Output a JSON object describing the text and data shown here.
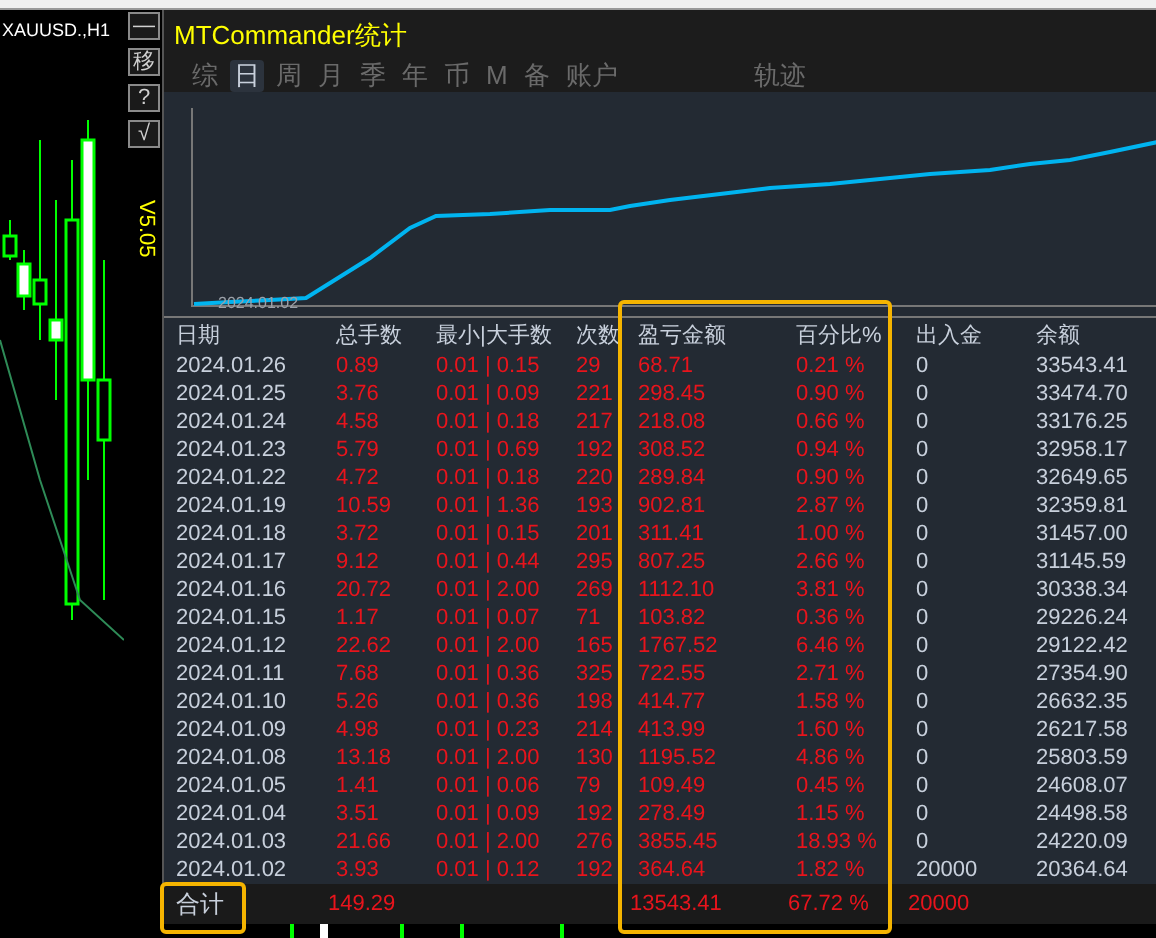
{
  "chart_window": {
    "symbol": "XAUUSD.,H1",
    "version": "V5.05",
    "side_buttons": [
      "—",
      "移",
      "?",
      "√"
    ]
  },
  "panel": {
    "title": "MTCommander统计",
    "tabs": [
      {
        "label": "综",
        "selected": false
      },
      {
        "label": "日",
        "selected": true
      },
      {
        "label": "周",
        "selected": false
      },
      {
        "label": "月",
        "selected": false
      },
      {
        "label": "季",
        "selected": false
      },
      {
        "label": "年",
        "selected": false
      },
      {
        "label": "币",
        "selected": false
      },
      {
        "label": "M",
        "selected": false
      },
      {
        "label": "备",
        "selected": false
      },
      {
        "label": "账户",
        "selected": false
      },
      {
        "label": "轨迹",
        "selected": false
      }
    ],
    "equity_chart": {
      "start_label": "2024.01.02"
    },
    "table": {
      "columns": [
        "日期",
        "总手数",
        "最小|大手数",
        "次数",
        "盈亏金额",
        "百分比%",
        "出入金",
        "余额"
      ],
      "rows": [
        [
          "2024.01.26",
          "0.89",
          "0.01 | 0.15",
          "29",
          "68.71",
          "0.21 %",
          "0",
          "33543.41"
        ],
        [
          "2024.01.25",
          "3.76",
          "0.01 | 0.09",
          "221",
          "298.45",
          "0.90 %",
          "0",
          "33474.70"
        ],
        [
          "2024.01.24",
          "4.58",
          "0.01 | 0.18",
          "217",
          "218.08",
          "0.66 %",
          "0",
          "33176.25"
        ],
        [
          "2024.01.23",
          "5.79",
          "0.01 | 0.69",
          "192",
          "308.52",
          "0.94 %",
          "0",
          "32958.17"
        ],
        [
          "2024.01.22",
          "4.72",
          "0.01 | 0.18",
          "220",
          "289.84",
          "0.90 %",
          "0",
          "32649.65"
        ],
        [
          "2024.01.19",
          "10.59",
          "0.01 | 1.36",
          "193",
          "902.81",
          "2.87 %",
          "0",
          "32359.81"
        ],
        [
          "2024.01.18",
          "3.72",
          "0.01 | 0.15",
          "201",
          "311.41",
          "1.00 %",
          "0",
          "31457.00"
        ],
        [
          "2024.01.17",
          "9.12",
          "0.01 | 0.44",
          "295",
          "807.25",
          "2.66 %",
          "0",
          "31145.59"
        ],
        [
          "2024.01.16",
          "20.72",
          "0.01 | 2.00",
          "269",
          "1112.10",
          "3.81 %",
          "0",
          "30338.34"
        ],
        [
          "2024.01.15",
          "1.17",
          "0.01 | 0.07",
          "71",
          "103.82",
          "0.36 %",
          "0",
          "29226.24"
        ],
        [
          "2024.01.12",
          "22.62",
          "0.01 | 2.00",
          "165",
          "1767.52",
          "6.46 %",
          "0",
          "29122.42"
        ],
        [
          "2024.01.11",
          "7.68",
          "0.01 | 0.36",
          "325",
          "722.55",
          "2.71 %",
          "0",
          "27354.90"
        ],
        [
          "2024.01.10",
          "5.26",
          "0.01 | 0.36",
          "198",
          "414.77",
          "1.58 %",
          "0",
          "26632.35"
        ],
        [
          "2024.01.09",
          "4.98",
          "0.01 | 0.23",
          "214",
          "413.99",
          "1.60 %",
          "0",
          "26217.58"
        ],
        [
          "2024.01.08",
          "13.18",
          "0.01 | 2.00",
          "130",
          "1195.52",
          "4.86 %",
          "0",
          "25803.59"
        ],
        [
          "2024.01.05",
          "1.41",
          "0.01 | 0.06",
          "79",
          "109.49",
          "0.45 %",
          "0",
          "24608.07"
        ],
        [
          "2024.01.04",
          "3.51",
          "0.01 | 0.09",
          "192",
          "278.49",
          "1.15 %",
          "0",
          "24498.58"
        ],
        [
          "2024.01.03",
          "21.66",
          "0.01 | 2.00",
          "276",
          "3855.45",
          "18.93 %",
          "0",
          "24220.09"
        ],
        [
          "2024.01.02",
          "3.93",
          "0.01 | 0.12",
          "192",
          "364.64",
          "1.82 %",
          "20000",
          "20364.64"
        ]
      ],
      "total": {
        "label": "合计",
        "total_lots": "149.29",
        "pnl": "13543.41",
        "percent": "67.72 %",
        "deposit": "20000"
      }
    }
  }
}
